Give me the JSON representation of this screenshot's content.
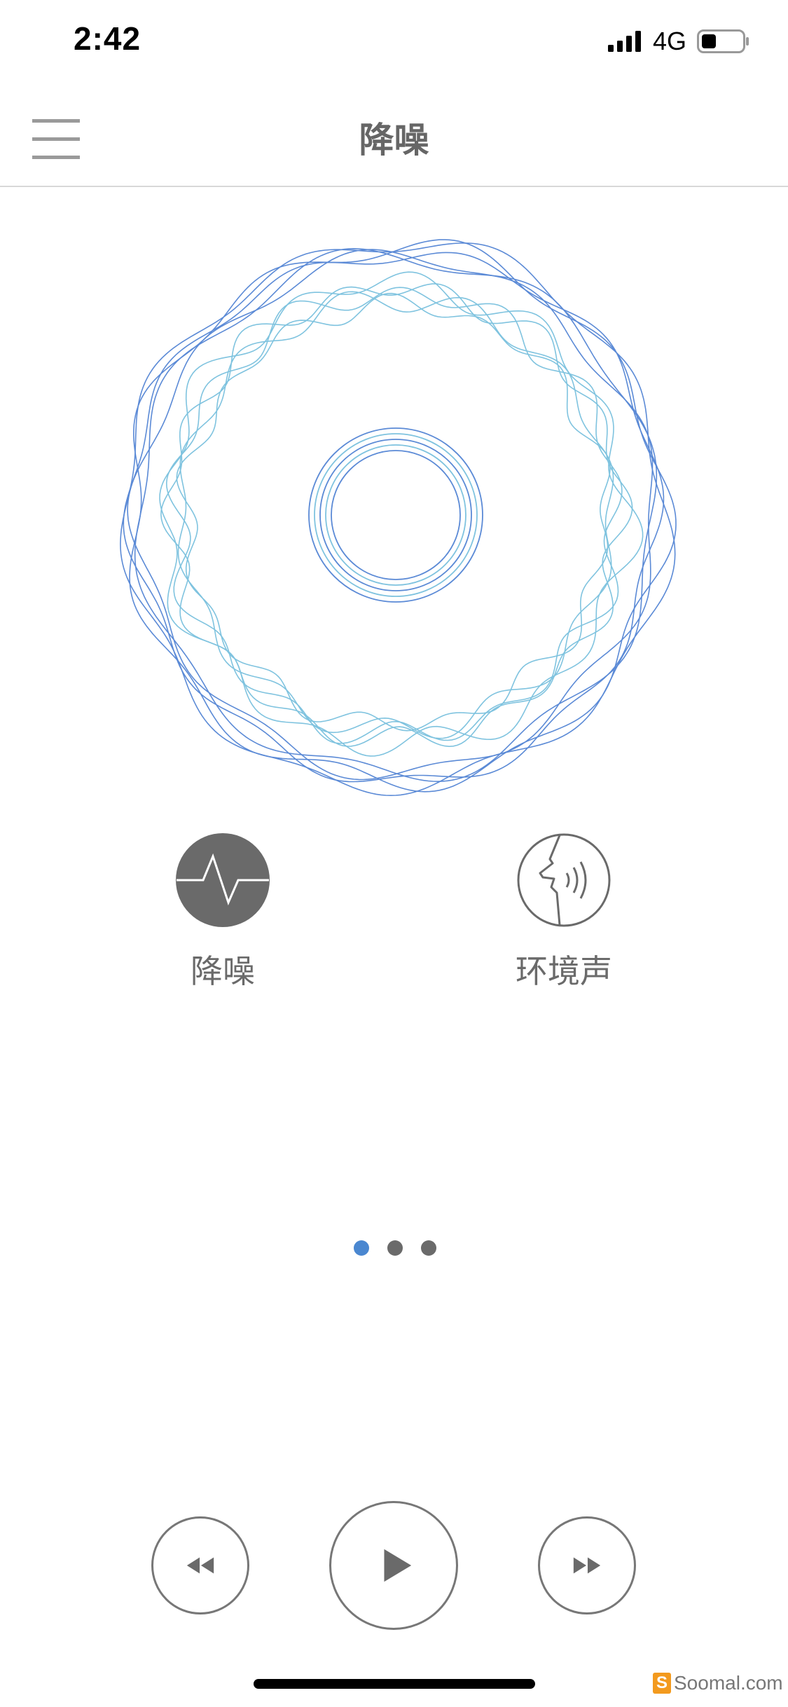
{
  "status_bar": {
    "time": "2:42",
    "network": "4G",
    "icons": [
      "signal-icon",
      "battery-icon"
    ]
  },
  "nav": {
    "title": "降噪",
    "menu_icon": "menu-icon"
  },
  "modes": [
    {
      "label": "降噪",
      "icon": "noise-cancel-icon",
      "selected": true
    },
    {
      "label": "环境声",
      "icon": "ambient-sound-icon",
      "selected": false
    }
  ],
  "pager": {
    "count": 3,
    "active_index": 0
  },
  "playback": {
    "icons": [
      "rewind-icon",
      "play-icon",
      "fast-forward-icon"
    ]
  },
  "watermark": {
    "text": "Soomal.com",
    "logo": "S"
  },
  "colors": {
    "accent": "#4a87d0",
    "wave_dark": "#5b8ad6",
    "wave_light": "#7fc3df",
    "icon_gray": "#6a6a6a"
  }
}
